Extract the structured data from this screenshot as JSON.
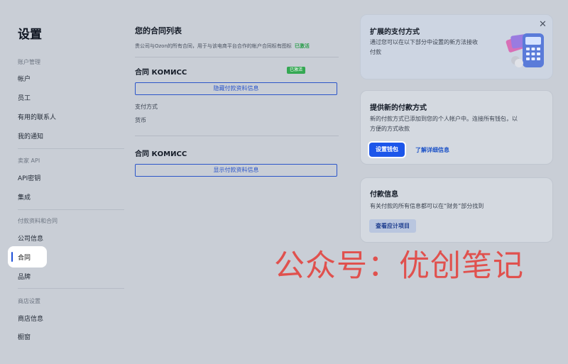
{
  "sidebar": {
    "title": "设置",
    "sections": [
      {
        "label": "账户管理",
        "items": [
          "帐户",
          "员工",
          "有用的联系人",
          "我的通知"
        ]
      },
      {
        "label": "卖家 API",
        "items": [
          "API密钥",
          "集成"
        ]
      },
      {
        "label": "付款资料和合同",
        "items": [
          "公司信息",
          "合同",
          "品牌"
        ]
      },
      {
        "label": "商店设置",
        "items": [
          "商店信息",
          "橱窗"
        ]
      }
    ],
    "active_item": "合同"
  },
  "contracts": {
    "title": "您的合同列表",
    "description": "贵公司与Ozon的所有合同，用于与该电商平台合作的帐户合同标有图标",
    "description_badge": "已激活",
    "items": [
      {
        "name": "合同 КОМИСС",
        "badge": "已激活",
        "button": "隐藏付款资料信息",
        "fields": [
          "支付方式",
          "货币"
        ]
      },
      {
        "name": "合同 КОМИСС",
        "button": "显示付款资料信息"
      }
    ]
  },
  "cards": {
    "extended": {
      "title": "扩展的支付方式",
      "text": [
        "通过您可以在以下部分中设置的新方法接收",
        "付款"
      ],
      "close_icon": "close-icon",
      "illustration": "payment-terminal-illustration"
    },
    "new_method": {
      "title": "提供新的付款方式",
      "text": [
        "新的付款方式已添加到您的个人帐户中。连接所有钱包，以",
        "方便的方式收款"
      ],
      "button": "设置钱包",
      "link": "了解详细信息"
    },
    "payment_info": {
      "title": "付款信息",
      "text": "有关付款的所有信息都可以在“财务”部分找到",
      "button": "查看应计项目"
    }
  },
  "watermark": "公众号：优创笔记",
  "colors": {
    "accent": "#1c56ea",
    "success": "#34a853",
    "watermark": "#e0514e"
  }
}
